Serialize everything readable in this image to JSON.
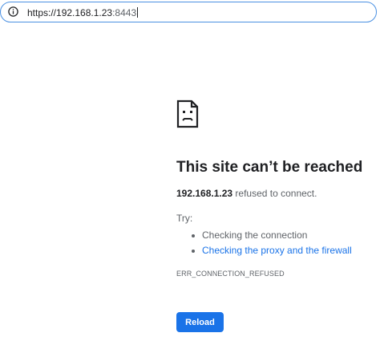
{
  "address_bar": {
    "url_main": "https://192.168.1.23",
    "url_port": ":8443",
    "icon": "info-icon"
  },
  "error_page": {
    "icon": "sad-page-icon",
    "title": "This site can’t be reached",
    "host": "192.168.1.23",
    "summary_suffix": " refused to connect.",
    "try_label": "Try:",
    "suggestions": [
      {
        "text": "Checking the connection",
        "is_link": false
      },
      {
        "text": "Checking the proxy and the firewall",
        "is_link": true
      }
    ],
    "error_code": "ERR_CONNECTION_REFUSED",
    "reload_label": "Reload"
  },
  "colors": {
    "accent": "#1a73e8",
    "text_primary": "#202124",
    "text_secondary": "#5f6368",
    "omnibox_border": "#4a90e2"
  }
}
